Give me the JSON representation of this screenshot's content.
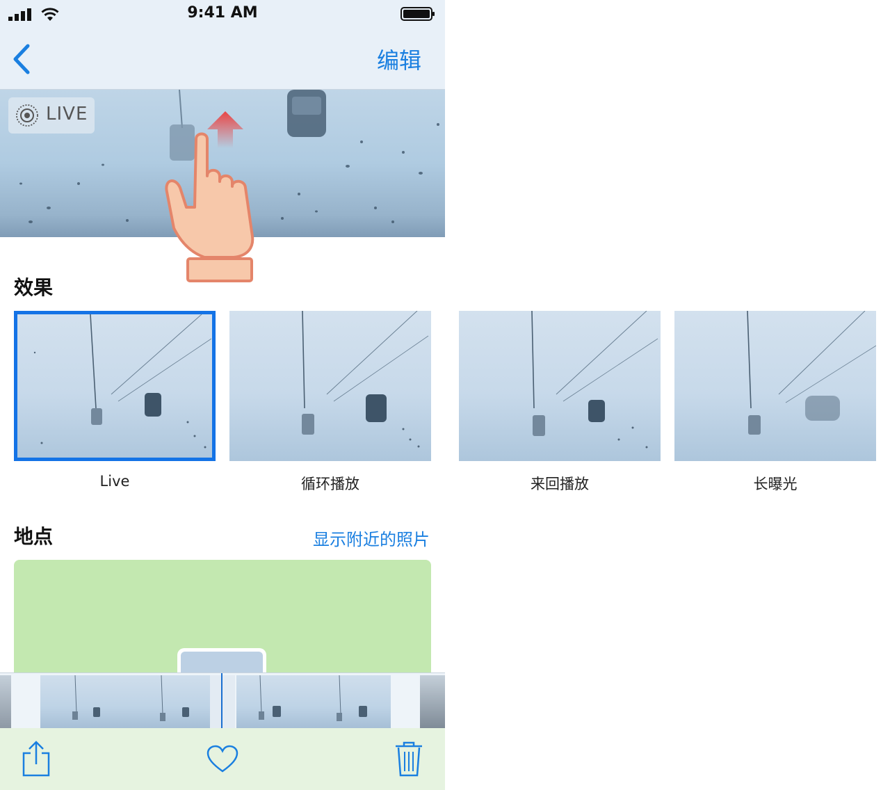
{
  "status_bar": {
    "time": "9:41 AM"
  },
  "nav": {
    "edit_label": "编辑"
  },
  "hero": {
    "live_badge": "LIVE"
  },
  "effects": {
    "title": "效果",
    "items": [
      {
        "label": "Live",
        "selected": true
      },
      {
        "label": "循环播放",
        "selected": false
      },
      {
        "label": "来回播放",
        "selected": false
      },
      {
        "label": "长曝光",
        "selected": false
      }
    ]
  },
  "location": {
    "title": "地点",
    "nearby_label": "显示附近的照片"
  },
  "toolbar": {
    "icons": [
      "share-icon",
      "heart-icon",
      "trash-icon"
    ]
  },
  "colors": {
    "accent": "#1a7fe0",
    "selection": "#1473e6",
    "map": "#c3e8b0",
    "hand": "#f7c8aa",
    "arrow": "#e94545"
  }
}
